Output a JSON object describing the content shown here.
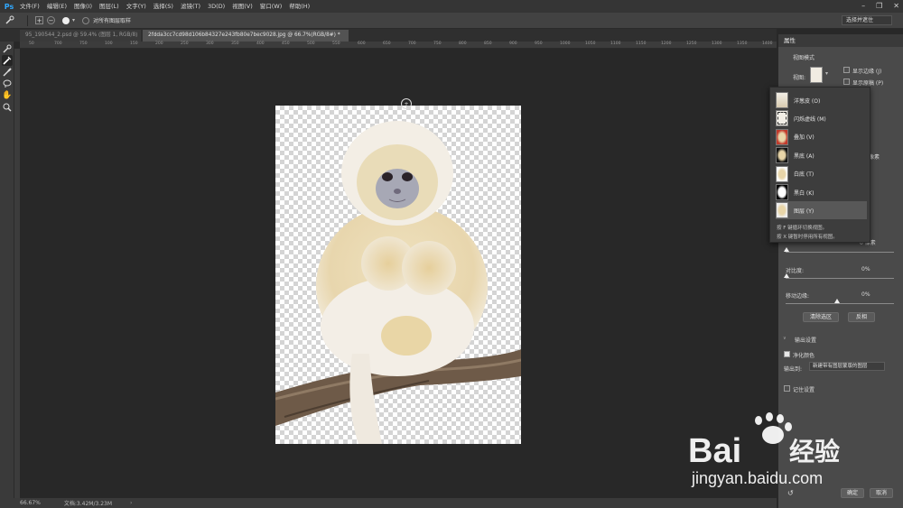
{
  "app": {
    "logo": "Ps"
  },
  "menubar": {
    "items": [
      "文件(F)",
      "编辑(E)",
      "图像(I)",
      "图层(L)",
      "文字(Y)",
      "选择(S)",
      "滤镜(T)",
      "3D(D)",
      "视图(V)",
      "窗口(W)",
      "帮助(H)"
    ],
    "win_min": "–",
    "win_max": "❐",
    "win_close": "✕"
  },
  "options": {
    "sample_all_layers": "对所有图层取样",
    "select_and_mask": "选择并遮住"
  },
  "tabs": [
    {
      "label": "95_190544_2.psd @ 59.4% (图层 1, RGB/8)"
    },
    {
      "label": "2fdda3cc7cd98d106b84327e243fb80e7bec9028.jpg @ 66.7%(RGB/8#) *"
    }
  ],
  "ruler": {
    "ticks": [
      "50",
      "700",
      "750",
      "100",
      "150",
      "200",
      "250",
      "300",
      "350",
      "400",
      "450",
      "500",
      "550",
      "600",
      "650",
      "700",
      "750",
      "800",
      "850",
      "900",
      "950",
      "1000",
      "1050",
      "1100",
      "1150",
      "1200",
      "1250",
      "1300",
      "1350",
      "1400",
      "1450"
    ]
  },
  "status": {
    "zoom": "66.67%",
    "doc_info": "文档:3.42M/3.23M"
  },
  "panel": {
    "title": "属性",
    "view_mode_heading": "视图模式",
    "view_label": "视图:",
    "show_edges": "显示边缘 (J)",
    "show_original": "显示原稿 (P)",
    "pixels_label": "像素",
    "radius_value": "0 像素",
    "contrast_label": "对比度:",
    "contrast_value": "0%",
    "shift_edge_label": "移动边缘:",
    "shift_edge_value": "0%",
    "clear_selection": "清除选区",
    "invert": "反相",
    "output_heading": "输出设置",
    "decontaminate": "净化颜色",
    "output_to_label": "输出到:",
    "output_to_value": "新建带有图层蒙版的图层",
    "remember": "记住设置",
    "ok": "确定",
    "cancel": "取消"
  },
  "view_dropdown": {
    "items": [
      {
        "label": "洋葱皮 (O)",
        "thumb": "onion"
      },
      {
        "label": "闪烁虚线 (M)",
        "thumb": "march"
      },
      {
        "label": "叠加 (V)",
        "thumb": "overlay"
      },
      {
        "label": "黑底 (A)",
        "thumb": "black"
      },
      {
        "label": "白底 (T)",
        "thumb": "white"
      },
      {
        "label": "黑白 (K)",
        "thumb": "bw"
      },
      {
        "label": "图层 (Y)",
        "thumb": "layer"
      }
    ],
    "selected": "图层 (Y)",
    "hint1": "按 F 键循环切换视图。",
    "hint2": "按 X 键暂时停用所有视图。"
  },
  "watermark": {
    "brand": "Bai",
    "brand2": "经验",
    "url": "jingyan.baidu.com"
  },
  "colors": {
    "accent": "#31a8ff",
    "menubar": "#353535",
    "panel": "#4a4a4a",
    "canvas": "#282828"
  }
}
